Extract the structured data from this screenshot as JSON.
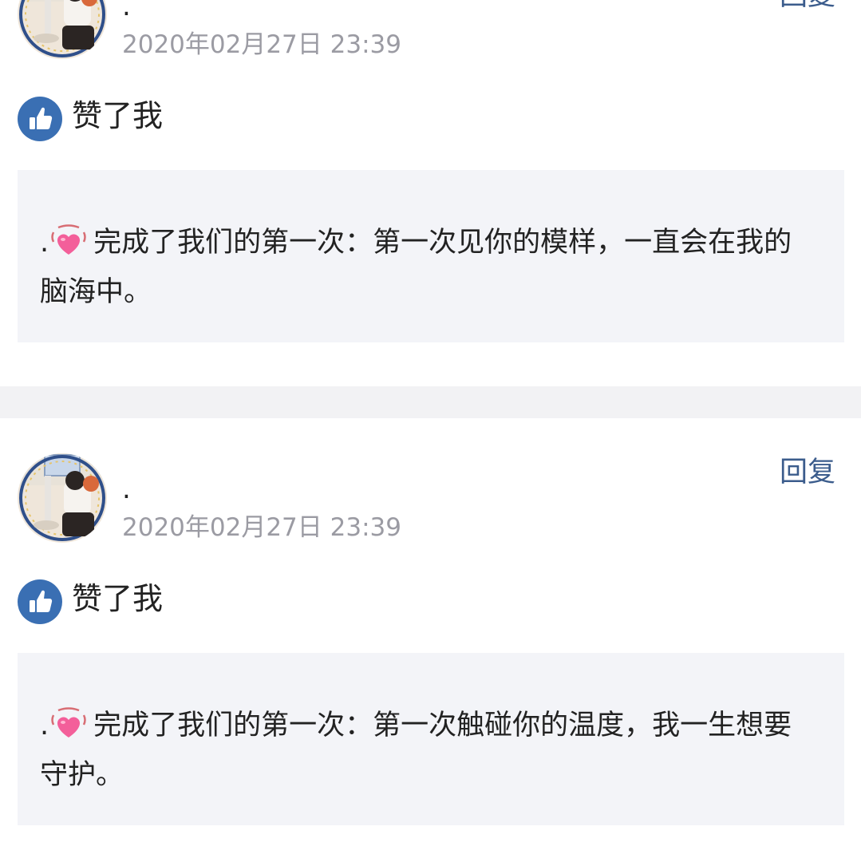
{
  "posts": [
    {
      "username": ".",
      "timestamp": "2020年02月27日 23:39",
      "reply_label": "回复",
      "like_text": "赞了我",
      "quote": {
        "prefix": ".",
        "text": "完成了我们的第一次：第一次见你的模样，一直会在我的脑海中。"
      }
    },
    {
      "username": ".",
      "timestamp": "2020年02月27日 23:39",
      "reply_label": "回复",
      "like_text": "赞了我",
      "quote": {
        "prefix": ".",
        "text": "完成了我们的第一次：第一次触碰你的温度，我一生想要守护。"
      }
    }
  ],
  "icons": {
    "like": "thumbs-up-icon",
    "heart": "beating-heart-icon"
  },
  "colors": {
    "reply_link": "#3b5c8c",
    "like_badge": "#3a6fb3",
    "timestamp": "#9b9ba3",
    "quote_background": "#f3f4f8",
    "separator": "#f2f2f4"
  }
}
